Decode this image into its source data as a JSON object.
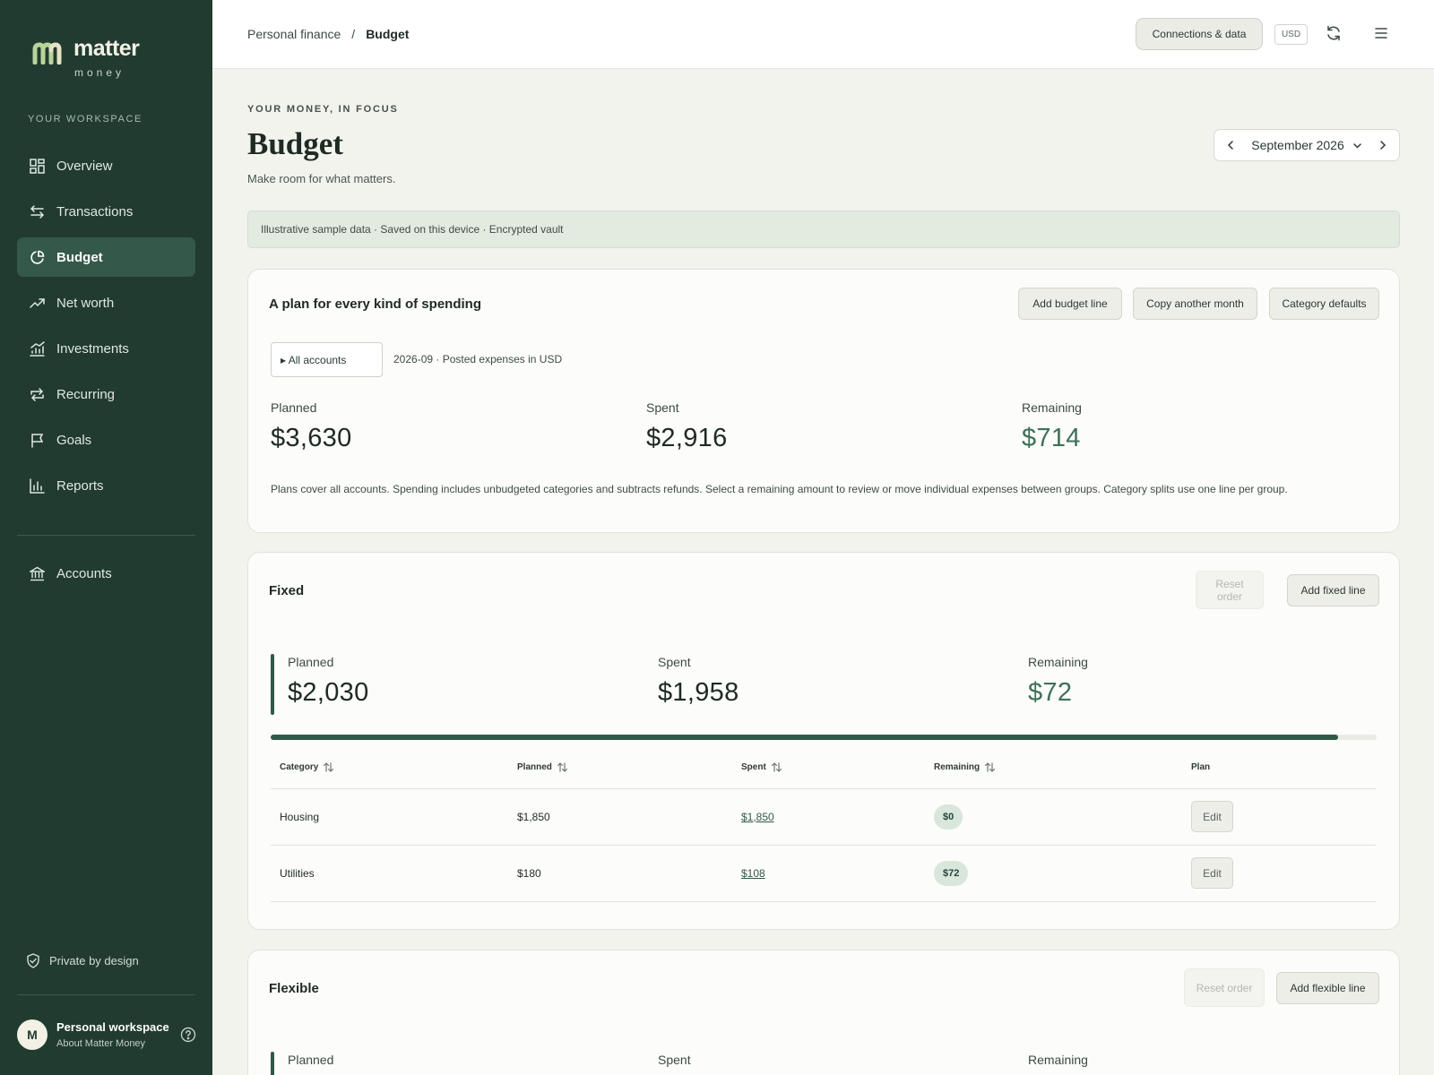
{
  "brand": {
    "name": "matter",
    "sub": "money"
  },
  "sidebar": {
    "section_label": "YOUR WORKSPACE",
    "items": [
      {
        "label": "Overview",
        "icon": "grid-icon"
      },
      {
        "label": "Transactions",
        "icon": "arrows-icon"
      },
      {
        "label": "Budget",
        "icon": "pie-icon",
        "active": true
      },
      {
        "label": "Net worth",
        "icon": "trend-icon"
      },
      {
        "label": "Investments",
        "icon": "chart-icon"
      },
      {
        "label": "Recurring",
        "icon": "repeat-icon"
      },
      {
        "label": "Goals",
        "icon": "flag-icon"
      },
      {
        "label": "Reports",
        "icon": "bar-chart-icon"
      }
    ],
    "accounts_label": "Accounts",
    "private_label": "Private by design",
    "profile": {
      "initial": "M",
      "name": "Personal workspace",
      "sub": "About Matter Money"
    }
  },
  "topbar": {
    "breadcrumb_parent": "Personal finance",
    "breadcrumb_sep": "/",
    "breadcrumb_current": "Budget",
    "connections_label": "Connections & data",
    "currency": "USD"
  },
  "header": {
    "eyebrow": "YOUR MONEY, IN FOCUS",
    "title": "Budget",
    "subtitle": "Make room for what matters.",
    "month": "September 2026"
  },
  "notice": "Illustrative sample data · Saved on this device · Encrypted vault",
  "plan": {
    "title": "A plan for every kind of spending",
    "add_line": "Add budget line",
    "copy_month": "Copy another month",
    "category_defaults": "Category defaults",
    "account_select": "▸ All accounts",
    "meta": "2026-09 · Posted expenses in USD",
    "planned_label": "Planned",
    "planned": "$3,630",
    "spent_label": "Spent",
    "spent": "$2,916",
    "remaining_label": "Remaining",
    "remaining": "$714",
    "note": "Plans cover all accounts. Spending includes unbudgeted categories and subtracts refunds. Select a remaining amount to review or move individual expenses between groups. Category splits use one line per group."
  },
  "fixed": {
    "title": "Fixed",
    "reset_label": "Reset order",
    "add_label": "Add fixed line",
    "planned_label": "Planned",
    "planned": "$2,030",
    "spent_label": "Spent",
    "spent": "$1,958",
    "remaining_label": "Remaining",
    "remaining": "$72",
    "progress_fraction": 0.965,
    "columns": [
      "Category",
      "Planned",
      "Spent",
      "Remaining",
      "Plan"
    ],
    "rows": [
      {
        "category": "Housing",
        "planned": "$1,850",
        "spent": "$1,850",
        "remaining": "$0",
        "action": "Edit"
      },
      {
        "category": "Utilities",
        "planned": "$180",
        "spent": "$108",
        "remaining": "$72",
        "action": "Edit"
      }
    ]
  },
  "flexible": {
    "title": "Flexible",
    "reset_label": "Reset order",
    "add_label": "Add flexible line",
    "planned_label": "Planned",
    "spent_label": "Spent",
    "remaining_label": "Remaining"
  },
  "colors": {
    "sidebar": "#213b30",
    "accent": "#2f5a47",
    "positive": "#3e7058",
    "background": "#f3f3ee"
  }
}
